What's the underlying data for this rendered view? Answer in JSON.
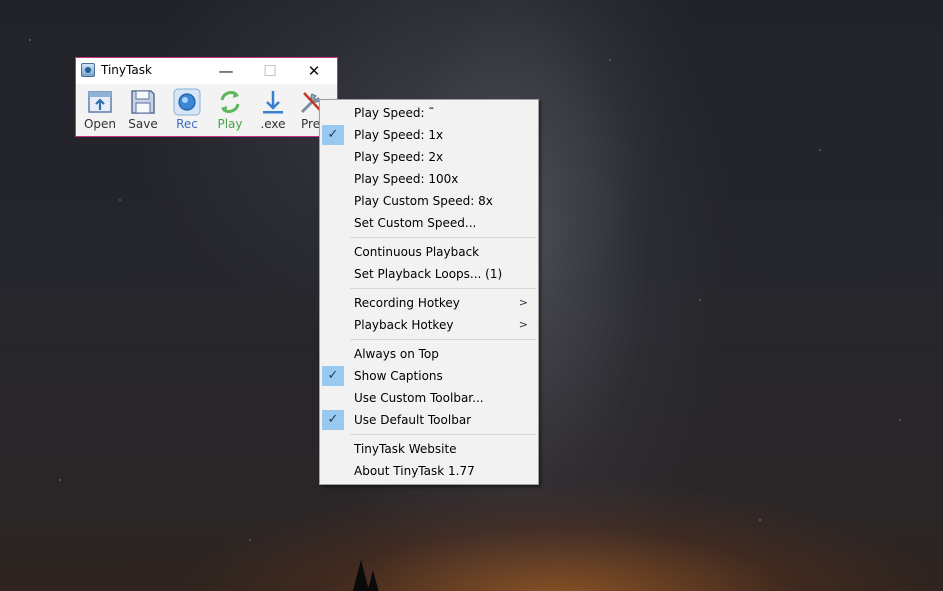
{
  "window": {
    "title": "TinyTask",
    "minimize_glyph": "—",
    "maximize_glyph": "☐",
    "close_glyph": "✕",
    "border_color": "#c5347e"
  },
  "toolbar": {
    "open": "Open",
    "save": "Save",
    "rec": "Rec",
    "play": "Play",
    "exe": ".exe",
    "prefs": "Prefs"
  },
  "menu": {
    "items": [
      {
        "label": "Play Speed:  ˜",
        "checked": false
      },
      {
        "label": "Play Speed:  1x",
        "checked": true
      },
      {
        "label": "Play Speed:  2x",
        "checked": false
      },
      {
        "label": "Play Speed:  100x",
        "checked": false
      },
      {
        "label": "Play Custom Speed:  8x",
        "checked": false
      },
      {
        "label": "Set Custom Speed...",
        "checked": false
      },
      {
        "label": "Continuous Playback",
        "checked": false
      },
      {
        "label": "Set Playback Loops...  (1)",
        "checked": false
      },
      {
        "label": "Recording Hotkey",
        "submenu": true
      },
      {
        "label": "Playback Hotkey",
        "submenu": true
      },
      {
        "label": "Always on Top",
        "checked": false
      },
      {
        "label": "Show Captions",
        "checked": true
      },
      {
        "label": "Use Custom Toolbar...",
        "checked": false
      },
      {
        "label": "Use Default Toolbar",
        "checked": true
      },
      {
        "label": "TinyTask Website",
        "checked": false
      },
      {
        "label": "About TinyTask 1.77",
        "checked": false
      }
    ],
    "check_glyph": "✓",
    "submenu_glyph": ">",
    "highlight_color": "#99c9ef"
  }
}
